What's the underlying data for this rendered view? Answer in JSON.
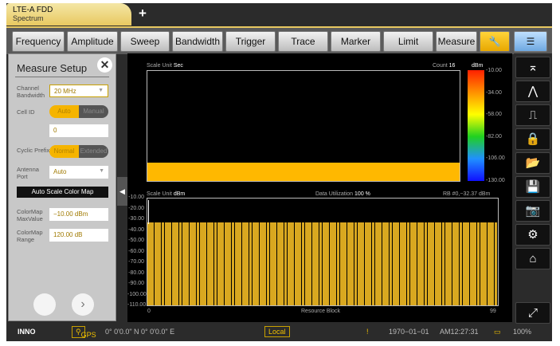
{
  "tab": {
    "title": "LTE-A FDD",
    "subtitle": "Spectrum",
    "add": "+"
  },
  "toolbar": [
    "Frequency",
    "Amplitude",
    "Sweep",
    "Bandwidth",
    "Trigger",
    "Trace",
    "Marker",
    "Limit",
    "Measure"
  ],
  "panel": {
    "title": "Measure Setup",
    "close": "✕",
    "channel_bw_label": "Channel Bandwidth",
    "channel_bw": "20 MHz",
    "cell_id_label": "Cell ID",
    "cell_auto": "Auto",
    "cell_manual": "Manual",
    "cell_value": "0",
    "cp_label": "Cyclic Prefix",
    "cp_normal": "Normal",
    "cp_extended": "Extended",
    "antenna_label": "Antenna Port",
    "antenna": "Auto",
    "autoscale": "Auto Scale Color Map",
    "cmax_label": "ColorMap MaxValue",
    "cmax": "−10.00 dBm",
    "crange_label": "ColorMap Range",
    "crange": "120.00 dB",
    "next": "›"
  },
  "spectrogram": {
    "scale_unit_label": "Scale Unit",
    "scale_unit": "Sec",
    "count_label": "Count",
    "count": "16",
    "unit": "dBm",
    "colorbar_ticks": [
      "-10.00",
      "-34.00",
      "-58.00",
      "-82.00",
      "-106.00",
      "-130.00"
    ]
  },
  "chart_data": {
    "type": "bar",
    "title": "",
    "scale_unit_label": "Scale Unit",
    "scale_unit": "dBm",
    "utilization_label": "Data Utilization",
    "utilization": "100 %",
    "marker": "RB #0,−32.37 dBm",
    "xlabel": "Resource Block",
    "x_ticks": [
      "0",
      "99"
    ],
    "ylim": [
      -110,
      -10
    ],
    "y_ticks": [
      "-10.00",
      "-20.00",
      "-30.00",
      "-40.00",
      "-50.00",
      "-60.00",
      "-70.00",
      "-80.00",
      "-90.00",
      "-100.00",
      "-110.00"
    ],
    "bar_count": 100,
    "value": -32.37,
    "color": "#d9a820"
  },
  "status": {
    "gps": "GPS",
    "coords": "0° 0'0.0\" N 0° 0'0.0\" E",
    "mode": "Local",
    "date": "1970−01−01",
    "time": "AM12:27:31",
    "battery": "100%"
  }
}
